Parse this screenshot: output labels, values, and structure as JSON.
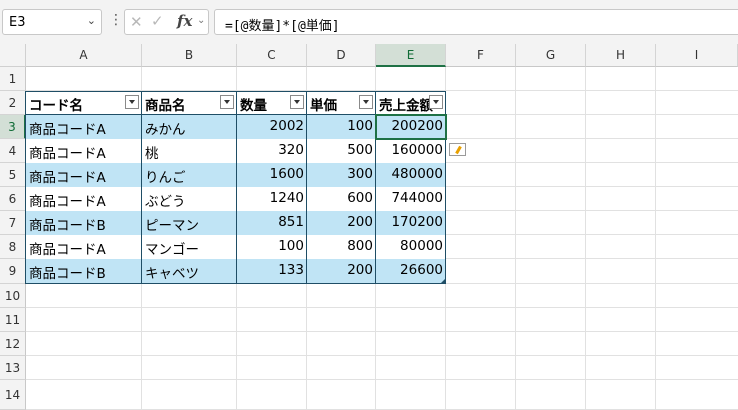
{
  "name_box": {
    "value": "E3"
  },
  "formula_bar": {
    "value": "=[@数量]*[@単価]"
  },
  "columns": [
    "A",
    "B",
    "C",
    "D",
    "E",
    "F",
    "G",
    "H",
    "I"
  ],
  "rows": [
    "1",
    "2",
    "3",
    "4",
    "5",
    "6",
    "7",
    "8",
    "9",
    "10",
    "11",
    "12",
    "13",
    "14"
  ],
  "selected": {
    "column": "E",
    "row": "3"
  },
  "table": {
    "headers": [
      "コード名",
      "商品名",
      "数量",
      "単価",
      "売上金額"
    ],
    "rows": [
      [
        "商品コードA",
        "みかん",
        "2002",
        "100",
        "200200"
      ],
      [
        "商品コードA",
        "桃",
        "320",
        "500",
        "160000"
      ],
      [
        "商品コードA",
        "りんご",
        "1600",
        "300",
        "480000"
      ],
      [
        "商品コードA",
        "ぶどう",
        "1240",
        "600",
        "744000"
      ],
      [
        "商品コードB",
        "ピーマン",
        "851",
        "200",
        "170200"
      ],
      [
        "商品コードA",
        "マンゴー",
        "100",
        "800",
        "80000"
      ],
      [
        "商品コードB",
        "キャベツ",
        "133",
        "200",
        "26600"
      ]
    ]
  },
  "colors": {
    "band": "#c0e4f5",
    "table_border": "#1f4e66",
    "selection": "#1e7145"
  },
  "icons": {
    "cancel": "close-icon",
    "enter": "check-icon",
    "function": "fx-icon",
    "smart_tag": "autofill-options-icon"
  }
}
